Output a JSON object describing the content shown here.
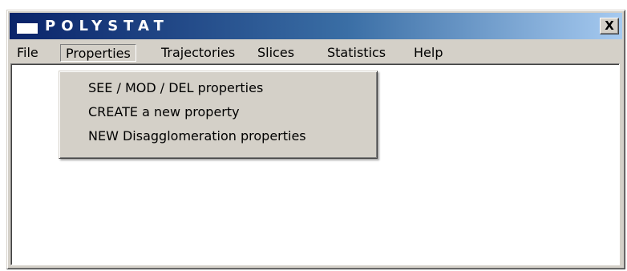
{
  "window": {
    "title": "POLYSTAT",
    "close_label": "X"
  },
  "menubar": {
    "items": [
      {
        "label": "File"
      },
      {
        "label": "Properties"
      },
      {
        "label": "Trajectories"
      },
      {
        "label": "Slices"
      },
      {
        "label": "Statistics"
      },
      {
        "label": "Help"
      }
    ],
    "open_menu": "Properties"
  },
  "properties_menu": {
    "items": [
      {
        "label": "SEE / MOD / DEL properties"
      },
      {
        "label": "CREATE a new property"
      },
      {
        "label": "NEW Disagglomeration properties"
      }
    ]
  },
  "colors": {
    "title_gradient_start": "#0a246a",
    "title_gradient_end": "#a6caf0",
    "chrome": "#d4d0c8"
  },
  "icons": [
    "app-window-icon",
    "close-icon"
  ]
}
